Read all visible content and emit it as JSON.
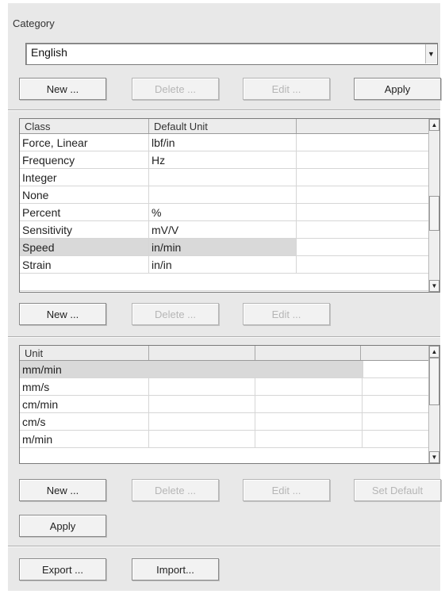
{
  "category": {
    "label": "Category",
    "selected": "English",
    "buttons": {
      "new": "New ...",
      "delete": "Delete ...",
      "edit": "Edit ...",
      "apply": "Apply"
    }
  },
  "class_table": {
    "headers": [
      "Class",
      "Default Unit",
      ""
    ],
    "rows": [
      {
        "class": "Force, Linear",
        "unit": "lbf/in"
      },
      {
        "class": "Frequency",
        "unit": "Hz"
      },
      {
        "class": "Integer",
        "unit": ""
      },
      {
        "class": "None",
        "unit": ""
      },
      {
        "class": "Percent",
        "unit": "%"
      },
      {
        "class": "Sensitivity",
        "unit": "mV/V"
      },
      {
        "class": "Speed",
        "unit": "in/min"
      },
      {
        "class": "Strain",
        "unit": "in/in"
      }
    ],
    "selected_class": "Speed",
    "buttons": {
      "new": "New ...",
      "delete": "Delete ...",
      "edit": "Edit ..."
    }
  },
  "unit_table": {
    "headers": [
      "Unit",
      "",
      "",
      ""
    ],
    "rows": [
      "mm/min",
      "mm/s",
      "cm/min",
      "cm/s",
      "m/min"
    ],
    "selected_unit": "mm/min",
    "buttons": {
      "new": "New ...",
      "delete": "Delete ...",
      "edit": "Edit ...",
      "set_default": "Set Default",
      "apply": "Apply"
    }
  },
  "footer": {
    "export": "Export ...",
    "import": "Import..."
  },
  "icons": {
    "dropdown": "chevron-down-icon",
    "scroll_up": "arrow-up-icon",
    "scroll_down": "arrow-down-icon"
  }
}
